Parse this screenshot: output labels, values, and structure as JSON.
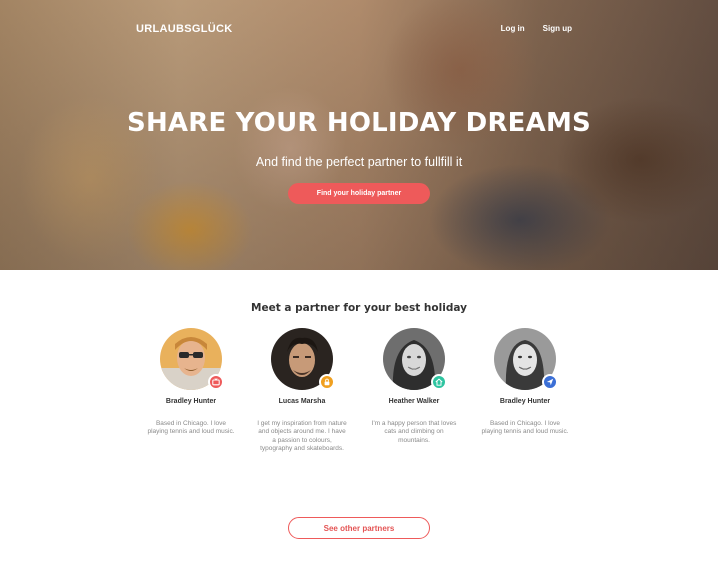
{
  "brand": {
    "logo": "URLAUBSGLÜCK"
  },
  "nav": {
    "login": "Log in",
    "signup": "Sign up"
  },
  "hero": {
    "title": "SHARE YOUR HOLIDAY DREAMS",
    "subtitle": "And find the perfect partner to fullfill it",
    "cta": "Find your holiday partner"
  },
  "section": {
    "title": "Meet a partner for your best holiday"
  },
  "partners": [
    {
      "name": "Bradley Hunter",
      "bio": "Based in Chicago. I love playing tennis and loud music.",
      "badge_icon": "tv-icon",
      "badge_color": "#ee5a5a"
    },
    {
      "name": "Lucas Marsha",
      "bio": "I get my inspiration from nature and objects around me. I have a passion to colours, typography and skateboards.",
      "badge_icon": "lock-icon",
      "badge_color": "#f0a020"
    },
    {
      "name": "Heather Walker",
      "bio": "I'm a happy person that loves cats and climbing on mountains.",
      "badge_icon": "home-icon",
      "badge_color": "#2ec4a0"
    },
    {
      "name": "Bradley Hunter",
      "bio": "Based in Chicago. I love playing tennis and loud music.",
      "badge_icon": "send-icon",
      "badge_color": "#3b6fd6"
    }
  ],
  "see_more": {
    "label": "See other partners"
  },
  "colors": {
    "accent": "#ee5a5a"
  }
}
